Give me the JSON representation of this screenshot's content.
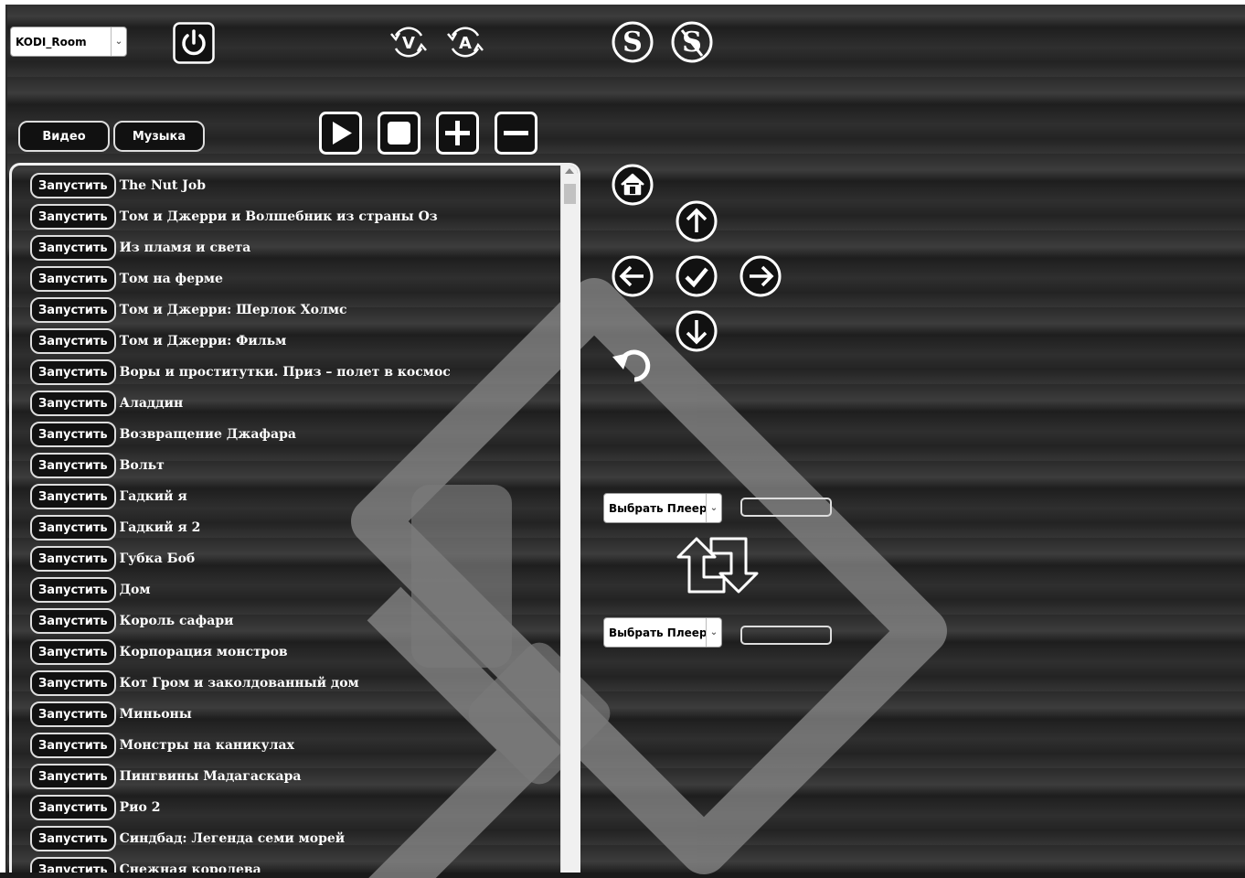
{
  "device_select": {
    "value": "KODI_Room"
  },
  "tabs": {
    "video": "Видео",
    "music": "Музыка"
  },
  "run_label": "Запустить",
  "movies": [
    "The Nut Job",
    "Том и Джерри и Волшебник из страны Оз",
    "Из пламя и света",
    "Том на ферме",
    "Том и Джерри: Шерлок Холмс",
    "Том и Джерри: Фильм",
    "Воры и проститутки. Приз – полет в космос",
    "Аладдин",
    "Возвращение Джафара",
    "Вольт",
    "Гадкий я",
    "Гадкий я 2",
    "Губка Боб",
    "Дом",
    "Король сафари",
    "Корпорация монстров",
    "Кот Гром и заколдованный дом",
    "Миньоны",
    "Монстры на каникулах",
    "Пингвины Мадагаскара",
    "Рио 2",
    "Синдбад: Легенда семи морей",
    "Снежная королева"
  ],
  "player_select_1": {
    "value": "Выбрать Плеер"
  },
  "player_select_2": {
    "value": "Выбрать Плеер"
  },
  "icons": {
    "top": [
      "power-icon",
      "video-sync-icon",
      "audio-sync-icon",
      "subtitles-on-icon",
      "subtitles-off-icon"
    ],
    "transport": [
      "play-icon",
      "stop-icon",
      "volume-up-icon",
      "volume-down-icon"
    ],
    "nav": [
      "home-icon",
      "up-arrow-icon",
      "left-arrow-icon",
      "ok-check-icon",
      "right-arrow-icon",
      "down-arrow-icon",
      "back-icon",
      "swap-players-icon"
    ]
  }
}
